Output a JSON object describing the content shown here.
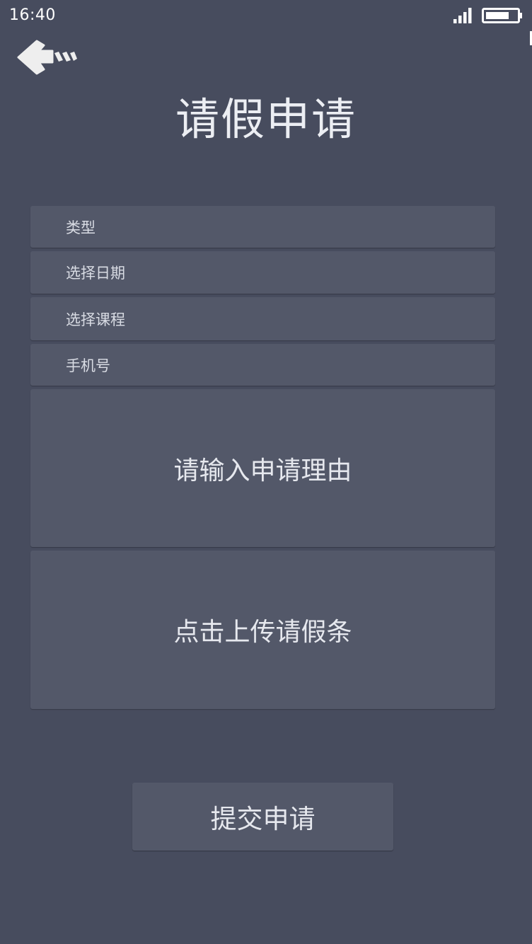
{
  "status_bar": {
    "time": "16:40",
    "signal_icon": "signal-icon",
    "battery_icon": "battery-icon"
  },
  "header": {
    "back_icon": "back-arrow-icon",
    "title": "请假申请"
  },
  "form": {
    "type_label": "类型",
    "date_label": "选择日期",
    "course_label": "选择课程",
    "phone_label": "手机号",
    "reason_placeholder": "请输入申请理由",
    "upload_label": "点击上传请假条"
  },
  "submit_label": "提交申请",
  "colors": {
    "background": "#474c5e",
    "panel": "#535869",
    "text": "#e6e8ee"
  }
}
